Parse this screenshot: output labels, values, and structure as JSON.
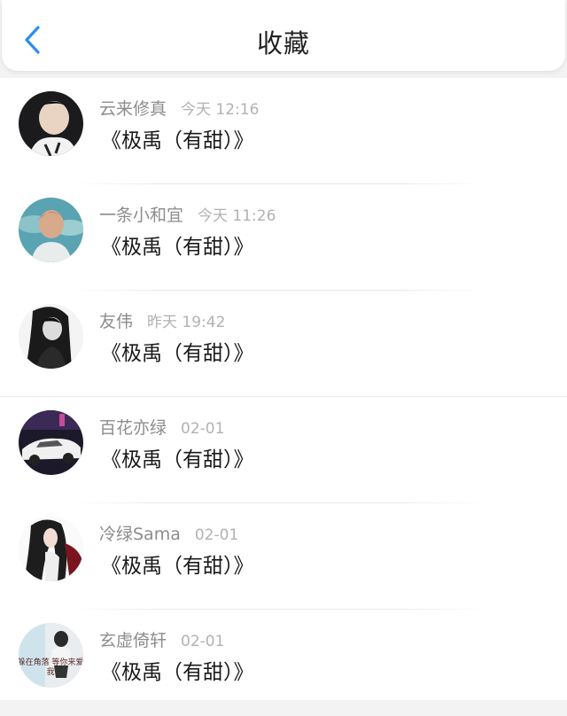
{
  "header": {
    "title": "收藏",
    "back_icon": "chevron-left-icon",
    "accent": "#2b8ef0"
  },
  "items": [
    {
      "name": "云来修真",
      "time": "今天 12:16",
      "message": "《极禹（有甜）》"
    },
    {
      "name": "一条小和宜",
      "time": "今天 11:26",
      "message": "《极禹（有甜）》"
    },
    {
      "name": "友伟",
      "time": "昨天 19:42",
      "message": "《极禹（有甜）》"
    },
    {
      "name": "百花亦绿",
      "time": "02-01",
      "message": "《极禹（有甜）》"
    },
    {
      "name": "冷绿Sama",
      "time": "02-01",
      "message": "《极禹（有甜）》"
    },
    {
      "name": "玄虚倚轩",
      "time": "02-01",
      "message": "《极禹（有甜）》",
      "avatar_text": "躲在角落 等你来爱我"
    }
  ]
}
